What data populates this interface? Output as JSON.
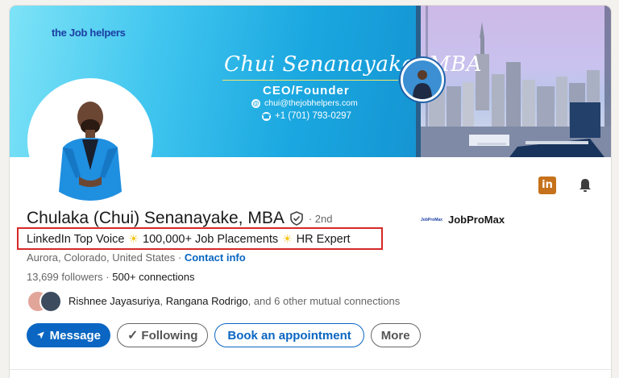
{
  "banner": {
    "logo": "the Job helpers",
    "signature": "Chui Senanayake, MBA",
    "role": "CEO/Founder",
    "email": "chui@thejobhelpers.com",
    "phone": "+1 (701) 793-0297"
  },
  "profile": {
    "name": "Chulaka (Chui) Senanayake, MBA",
    "degree": "· 2nd",
    "headline": {
      "part1": "LinkedIn Top Voice",
      "part2": "100,000+ Job Placements",
      "part3": "HR Expert"
    },
    "location": "Aurora, Colorado, United States",
    "location_sep": " · ",
    "contact_link": "Contact info",
    "followers": "13,699 followers",
    "connections": "500+ connections",
    "connections_sep": " · ",
    "mutual_name_1": "Rishnee Jayasuriya",
    "mutual_sep": ", ",
    "mutual_name_2": "Rangana Rodrigo",
    "mutual_rest": ", and 6 other mutual connections",
    "company": "JobProMax",
    "company_logo_text": "JobProMax"
  },
  "actions": {
    "message": "Message",
    "following": "Following",
    "appointment": "Book an appointment",
    "more": "More",
    "linkedin_icon": "in"
  },
  "colors": {
    "accent": "#0a66c2",
    "highlight_border": "#d62828"
  }
}
